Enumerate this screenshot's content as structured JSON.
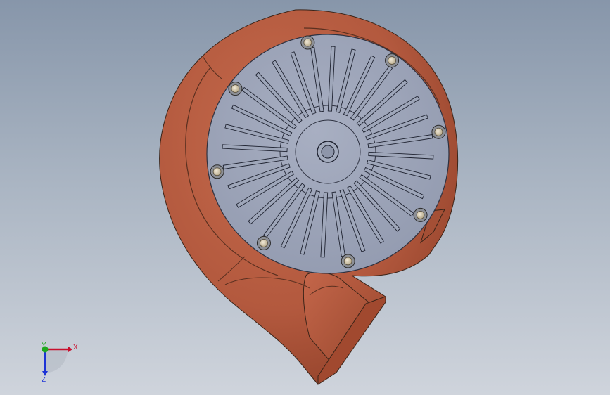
{
  "viewport": {
    "background_top": "#8796aa",
    "background_bottom": "#cfd4dc"
  },
  "model": {
    "housing_color": "#b3593e",
    "cover_color": "#9aa2b7",
    "blade_count": 32,
    "bolt_count": 8
  },
  "triad": {
    "x_label": "X",
    "y_label": "Y",
    "z_label": "Z",
    "x_color": "#c8102e",
    "y_color": "#1ea81e",
    "z_color": "#1d33d6"
  }
}
